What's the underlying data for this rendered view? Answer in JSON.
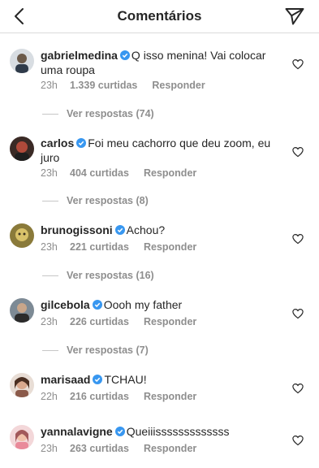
{
  "header": {
    "title": "Comentários"
  },
  "comments": [
    {
      "username": "gabrielmedina",
      "text": "Q isso menina! Vai colocar uma roupa",
      "time": "23h",
      "likes": "1.339 curtidas",
      "reply": "Responder",
      "view_replies": "Ver respostas (74)"
    },
    {
      "username": "carlos",
      "text": "Foi meu cachorro que deu zoom, eu juro",
      "time": "23h",
      "likes": "404 curtidas",
      "reply": "Responder",
      "view_replies": "Ver respostas (8)"
    },
    {
      "username": "brunogissoni",
      "text": "Achou?",
      "time": "23h",
      "likes": "221 curtidas",
      "reply": "Responder",
      "view_replies": "Ver respostas (16)"
    },
    {
      "username": "gilcebola",
      "text": "Oooh my father",
      "time": "23h",
      "likes": "226 curtidas",
      "reply": "Responder",
      "view_replies": "Ver respostas (7)"
    },
    {
      "username": "marisaad",
      "text": "TCHAU!",
      "time": "22h",
      "likes": "216 curtidas",
      "reply": "Responder"
    },
    {
      "username": "yannalavigne",
      "text": "Queiiisssssssssssss",
      "time": "23h",
      "likes": "263 curtidas",
      "reply": "Responder"
    }
  ],
  "icons": {
    "back": "chevron-left-icon",
    "send": "paper-plane-icon",
    "like": "heart-icon",
    "verified": "verified-badge-icon"
  },
  "colors": {
    "text": "#262626",
    "muted": "#8e8e8e",
    "verified": "#3897f0",
    "divider": "#dbdbdb"
  }
}
